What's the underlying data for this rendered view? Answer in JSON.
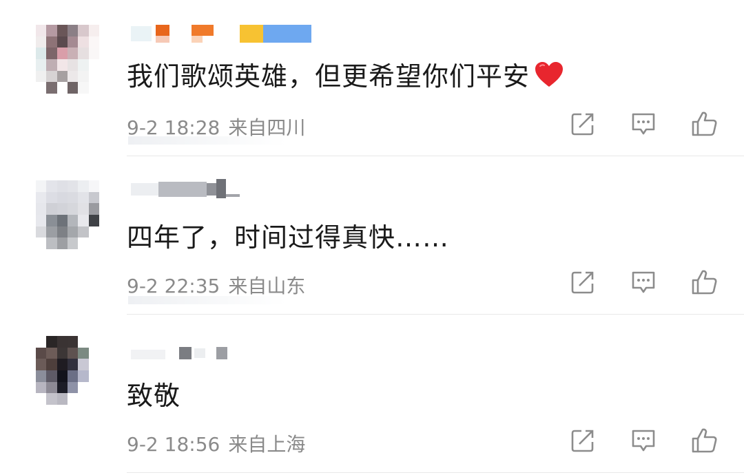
{
  "comments": [
    {
      "text": "我们歌颂英雄，但更希望你们平安",
      "has_heart": true,
      "date_time": "9-2 18:28",
      "location": "来自四川",
      "avatar_colors": [
        "#f1e7ea",
        "#b59aa2",
        "#6a5658",
        "#8b7f86",
        "#d8c8cc",
        "#f6eeee",
        "#f0ecec",
        "#8e7377",
        "#5b4a4e",
        "#a58a92",
        "#eee0e2",
        "#fbf7f7",
        "#dce9ea",
        "#7d6569",
        "#d99ea9",
        "#c9b0b5",
        "#e6dfe0",
        "#faf7f7",
        "#e8eff0",
        "#bfaeb3",
        "#f2e6e8",
        "#e7e2e3",
        "#eef2f2",
        "#ffffff",
        "#f0f0f0",
        "#d7d3d4",
        "#a6a0a1",
        "#ece8e9",
        "#f3f3f3",
        "#ffffff",
        "#ffffff",
        "#7a6e70",
        "#ffffff",
        "#6f6466",
        "#f7f7f7",
        "#ffffff"
      ]
    },
    {
      "text": "四年了，时间过得真快……",
      "has_heart": false,
      "date_time": "9-2 22:35",
      "location": "来自山东",
      "avatar_colors": [
        "#f3f4f6",
        "#e3e4ea",
        "#dfe0e6",
        "#e2e3e8",
        "#eceef1",
        "#f6f6f8",
        "#e8e9ee",
        "#dcdde4",
        "#d8d9e0",
        "#dadbe1",
        "#e2e3e8",
        "#c8c9cf",
        "#e6e7ec",
        "#cfd0d6",
        "#d2d3d9",
        "#d6d7dc",
        "#e1e1e5",
        "#9a9ba0",
        "#e7e8ed",
        "#8a8f96",
        "#6d7279",
        "#b3b6bb",
        "#e8e8ec",
        "#3f4246",
        "#d9dade",
        "#9b9ea3",
        "#7e8186",
        "#a4a7ab",
        "#c2c3c7",
        "#ffffff",
        "#ffffff",
        "#bcbec2",
        "#9d9fa3",
        "#c7c9cc",
        "#ffffff",
        "#ffffff"
      ]
    },
    {
      "text": "致敬",
      "has_heart": false,
      "date_time": "9-2 18:56",
      "location": "来自上海",
      "avatar_colors": [
        "#ffffff",
        "#2a2626",
        "#3a3333",
        "#3b3434",
        "#ffffff",
        "#ffffff",
        "#5a4a48",
        "#6d5c58",
        "#3c3636",
        "#5e5250",
        "#7b8a82",
        "#ffffff",
        "#6b5b58",
        "#4e3f3c",
        "#1f1c22",
        "#31303d",
        "#c9c8d4",
        "#ffffff",
        "#8b8e9b",
        "#5d5a66",
        "#12131c",
        "#6b6f86",
        "#b6b8cb",
        "#ffffff",
        "#b7b5c0",
        "#8d8a95",
        "#1c1d27",
        "#8e92a7",
        "#ffffff",
        "#ffffff",
        "#ffffff",
        "#c4c3cb",
        "#b9b8c1",
        "#ffffff",
        "#ffffff",
        "#ffffff"
      ]
    }
  ],
  "colors": {
    "text": "#1a1a1a",
    "meta": "#8a8a8a",
    "icon": "#8c8c8c",
    "heart": "#e8262e",
    "divider": "#e8e8e8"
  },
  "icons": [
    "share-icon",
    "reply-icon",
    "like-icon"
  ]
}
